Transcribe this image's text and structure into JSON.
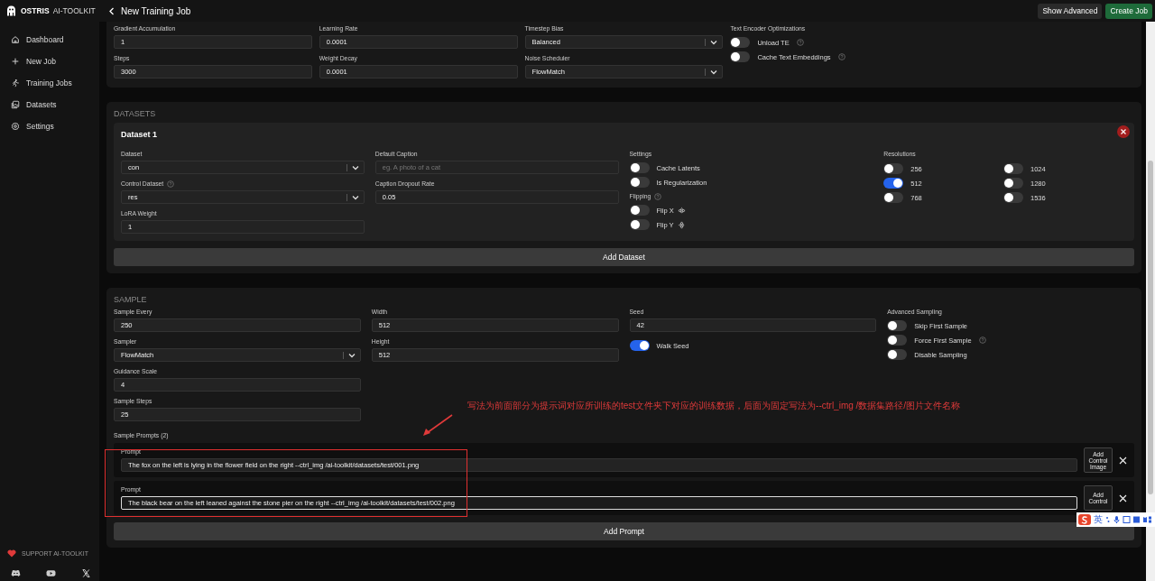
{
  "app": {
    "brand": "OSTRIS",
    "brand_suffix": "AI-TOOLKIT"
  },
  "header": {
    "title": "New Training Job",
    "buttons": [
      {
        "label": "Show Advanced",
        "kind": "secondary"
      },
      {
        "label": "Create Job",
        "kind": "primary"
      }
    ]
  },
  "sidebar": {
    "items": [
      {
        "label": "Dashboard"
      },
      {
        "label": "New Job"
      },
      {
        "label": "Training Jobs"
      },
      {
        "label": "Datasets"
      },
      {
        "label": "Settings"
      }
    ],
    "support": "SUPPORT AI-TOOLKIT"
  },
  "training": {
    "columns": [
      [
        {
          "kind": "input",
          "label": "Gradient Accumulation",
          "value": "1"
        },
        {
          "kind": "input",
          "label": "Steps",
          "value": "3000"
        }
      ],
      [
        {
          "kind": "input",
          "label": "Learning Rate",
          "value": "0.0001"
        },
        {
          "kind": "input",
          "label": "Weight Decay",
          "value": "0.0001"
        }
      ],
      [
        {
          "kind": "select",
          "label": "Timestep Bias",
          "value": "Balanced"
        },
        {
          "kind": "select",
          "label": "Noise Scheduler",
          "value": "FlowMatch"
        }
      ],
      [
        {
          "kind": "toggles",
          "label": "Text Encoder Optimizations",
          "toggles": [
            {
              "label": "Unload TE",
              "on": false,
              "help": true
            },
            {
              "label": "Cache Text Embeddings",
              "on": false,
              "help": true
            }
          ]
        }
      ]
    ]
  },
  "datasets": {
    "title": "DATASETS",
    "items": [
      {
        "title": "Dataset 1",
        "columns": [
          [
            {
              "kind": "select",
              "label": "Dataset",
              "value": "con"
            },
            {
              "kind": "select",
              "label": "Control Dataset",
              "value": "res",
              "help": true
            },
            {
              "kind": "input",
              "label": "LoRA Weight",
              "value": "1"
            }
          ],
          [
            {
              "kind": "input",
              "label": "Default Caption",
              "placeholder": "eg. A photo of a cat"
            },
            {
              "kind": "input",
              "label": "Caption Dropout Rate",
              "value": "0.05"
            }
          ],
          [
            {
              "kind": "toggles",
              "label": "Settings",
              "toggles": [
                {
                  "label": "Cache Latents",
                  "on": false
                },
                {
                  "label": "Is Regularization",
                  "on": false
                }
              ]
            },
            {
              "kind": "flip-toggles",
              "label": "Flipping",
              "help": true,
              "toggles": [
                {
                  "label": "Flip X",
                  "on": false
                },
                {
                  "label": "Flip Y",
                  "on": false
                }
              ]
            }
          ],
          [
            {
              "kind": "toggle-grid",
              "label": "Resolutions",
              "toggles": [
                {
                  "label": "256",
                  "on": false
                },
                {
                  "label": "512",
                  "on": true
                },
                {
                  "label": "768",
                  "on": false
                },
                {
                  "label": "1024",
                  "on": false
                },
                {
                  "label": "1280",
                  "on": false
                },
                {
                  "label": "1536",
                  "on": false
                }
              ]
            }
          ]
        ]
      }
    ],
    "add_button": "Add Dataset"
  },
  "sample": {
    "title": "SAMPLE",
    "columns": [
      [
        {
          "kind": "input",
          "label": "Sample Every",
          "value": "250"
        },
        {
          "kind": "select",
          "label": "Sampler",
          "value": "FlowMatch"
        },
        {
          "kind": "input",
          "label": "Guidance Scale",
          "value": "4"
        },
        {
          "kind": "input",
          "label": "Sample Steps",
          "value": "25"
        }
      ],
      [
        {
          "kind": "input",
          "label": "Width",
          "value": "512"
        },
        {
          "kind": "input",
          "label": "Height",
          "value": "512"
        }
      ],
      [
        {
          "kind": "input",
          "label": "Seed",
          "value": "42"
        },
        {
          "kind": "toggles",
          "toggles": [
            {
              "label": "Walk Seed",
              "on": true
            }
          ]
        }
      ],
      [
        {
          "kind": "toggles",
          "label": "Advanced Sampling",
          "toggles": [
            {
              "label": "Skip First Sample",
              "on": false
            },
            {
              "label": "Force First Sample",
              "on": false,
              "help": true
            },
            {
              "label": "Disable Sampling",
              "on": false
            }
          ]
        }
      ]
    ],
    "prompts_label": "Sample Prompts (2)",
    "prompts": [
      {
        "label": "Prompt",
        "value": "The fox on the left is lying in the flower field on the right --ctrl_img /ai-toolkit/datasets/test/001.png",
        "focused": false,
        "add_label": "Add Control Image"
      },
      {
        "label": "Prompt",
        "value": "The black bear on the left leaned against the stone pier on the right --ctrl_img /ai-toolkit/datasets/test/002.png",
        "focused": true,
        "add_label": "Add Control"
      }
    ],
    "add_button": "Add Prompt"
  },
  "annotation": {
    "text": "写法为前面部分为提示词对应所训练的test文件夹下对应的训练数据，后面为固定写法为--ctrl_img /数据集路径/图片文件名称"
  },
  "ime": {
    "label": "英"
  }
}
